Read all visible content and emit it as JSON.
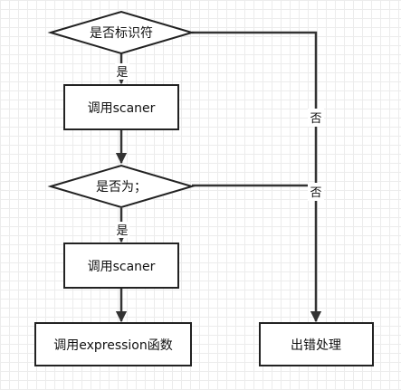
{
  "nodes": {
    "is_identifier": "是否标识符",
    "call_scanner_1": "调用scaner",
    "is_semicolon": "是否为；",
    "call_scanner_2": "调用scaner",
    "call_expression": "调用expression函数",
    "error_handling": "出错处理"
  },
  "edges": {
    "yes_1": "是",
    "no_1": "否",
    "yes_2": "是",
    "no_2": "否"
  },
  "colors": {
    "line": "#333333",
    "border": "#222222",
    "grid": "#ececec"
  }
}
